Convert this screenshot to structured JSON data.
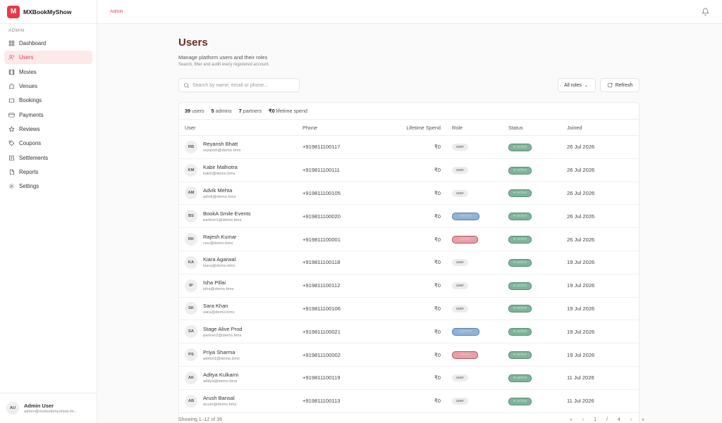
{
  "brand": {
    "logo": "M",
    "name": "MXBookMyShow"
  },
  "sidebar": {
    "section": "ADMIN",
    "items": [
      {
        "label": "Dashboard",
        "icon": "grid-icon",
        "active": false
      },
      {
        "label": "Users",
        "icon": "users-icon",
        "active": true
      },
      {
        "label": "Movies",
        "icon": "film-icon",
        "active": false
      },
      {
        "label": "Venues",
        "icon": "building-icon",
        "active": false
      },
      {
        "label": "Bookings",
        "icon": "ticket-icon",
        "active": false
      },
      {
        "label": "Payments",
        "icon": "card-icon",
        "active": false
      },
      {
        "label": "Reviews",
        "icon": "star-icon",
        "active": false
      },
      {
        "label": "Coupons",
        "icon": "tag-icon",
        "active": false
      },
      {
        "label": "Settlements",
        "icon": "receipt-icon",
        "active": false
      },
      {
        "label": "Reports",
        "icon": "file-icon",
        "active": false
      },
      {
        "label": "Settings",
        "icon": "gear-icon",
        "active": false
      }
    ],
    "user": {
      "initials": "AU",
      "name": "Admin User",
      "email": "admin@mxbookmyshow.mi..."
    }
  },
  "topbar": {
    "crumb": "Admin"
  },
  "page": {
    "title": "Users",
    "subtitle": "Manage platform users and their roles",
    "hint": "Search, filter and audit every registered account."
  },
  "toolbar": {
    "search_placeholder": "Search by name, email or phone...",
    "role_filter": "All roles",
    "refresh": "Refresh"
  },
  "stats": {
    "users_count": "39",
    "users_label": "users",
    "admins_count": "5",
    "admins_label": "admins",
    "partners_count": "7",
    "partners_label": "partners",
    "spend": "₹0",
    "spend_label": "lifetime spend"
  },
  "columns": {
    "user": "User",
    "phone": "Phone",
    "spend": "Lifetime Spend",
    "role": "Role",
    "status": "Status",
    "joined": "Joined"
  },
  "rows": [
    {
      "initials": "RB",
      "name": "Reyansh Bhatt",
      "email": "reyansh@demo.bms",
      "phone": "+919811100117",
      "spend": "₹0",
      "role": "user",
      "status": "● active",
      "joined": "26 Jul 2026"
    },
    {
      "initials": "KM",
      "name": "Kabir Malhotra",
      "email": "kabir@demo.bms",
      "phone": "+919811100111",
      "spend": "₹0",
      "role": "user",
      "status": "● active",
      "joined": "26 Jul 2026"
    },
    {
      "initials": "AM",
      "name": "Advik Mehta",
      "email": "advik@demo.bms",
      "phone": "+919811100105",
      "spend": "₹0",
      "role": "user",
      "status": "● active",
      "joined": "26 Jul 2026"
    },
    {
      "initials": "BS",
      "name": "BookA Smile Events",
      "email": "partner1@demo.bms",
      "phone": "+919811100020",
      "spend": "₹0",
      "role": "partner",
      "status": "● active",
      "joined": "26 Jul 2026"
    },
    {
      "initials": "RK",
      "name": "Rajesh Kumar",
      "email": "ceo@demo.bms",
      "phone": "+919811100001",
      "spend": "₹0",
      "role": "admin",
      "status": "● active",
      "joined": "26 Jul 2026"
    },
    {
      "initials": "KA",
      "name": "Kiara Agarwal",
      "email": "kiara@demo.bms",
      "phone": "+919811100118",
      "spend": "₹0",
      "role": "user",
      "status": "● active",
      "joined": "19 Jul 2026"
    },
    {
      "initials": "IP",
      "name": "Isha Pillai",
      "email": "isha@demo.bms",
      "phone": "+919811100112",
      "spend": "₹0",
      "role": "user",
      "status": "● active",
      "joined": "19 Jul 2026"
    },
    {
      "initials": "SK",
      "name": "Sara Khan",
      "email": "sara@demo.bms",
      "phone": "+919811100106",
      "spend": "₹0",
      "role": "user",
      "status": "● active",
      "joined": "19 Jul 2026"
    },
    {
      "initials": "SA",
      "name": "Stage Alive Prod",
      "email": "partner2@demo.bms",
      "phone": "+919811100021",
      "spend": "₹0",
      "role": "partner",
      "status": "● active",
      "joined": "19 Jul 2026"
    },
    {
      "initials": "PS",
      "name": "Priya Sharma",
      "email": "admin1@demo.bms",
      "phone": "+919811100002",
      "spend": "₹0",
      "role": "admin",
      "status": "● active",
      "joined": "19 Jul 2026"
    },
    {
      "initials": "AK",
      "name": "Aditya Kulkarni",
      "email": "aditya@demo.bms",
      "phone": "+919811100119",
      "spend": "₹0",
      "role": "user",
      "status": "● active",
      "joined": "11 Jul 2026"
    },
    {
      "initials": "AB",
      "name": "Arush Bansal",
      "email": "arush@demo.bms",
      "phone": "+919811100113",
      "spend": "₹0",
      "role": "user",
      "status": "● active",
      "joined": "11 Jul 2026"
    }
  ],
  "footer": {
    "showing": "Showing 1–12 of 39",
    "pager": "« ‹ 1 / 4 › »"
  }
}
